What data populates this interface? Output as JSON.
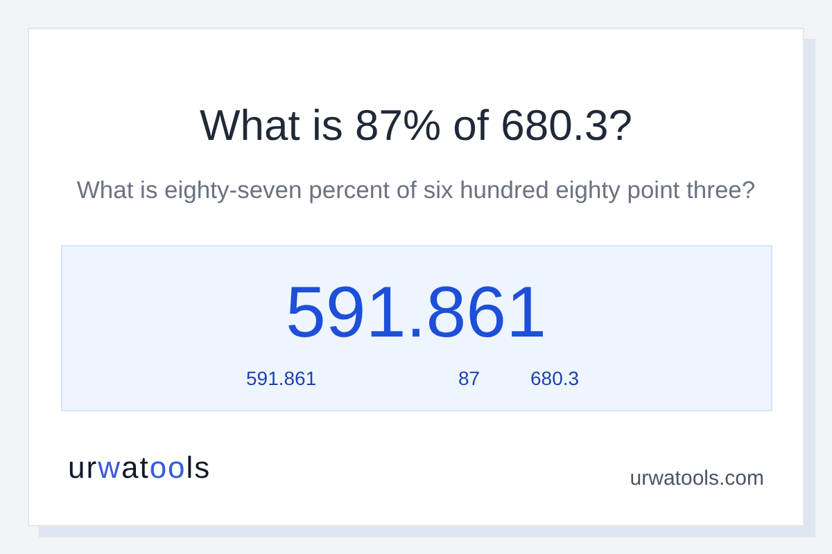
{
  "title": "What is 87% of 680.3?",
  "subtitle": "What is eighty-seven percent of six hundred eighty point three?",
  "result": {
    "value": "591.861",
    "parts": [
      "591.861",
      "87",
      "680.3"
    ]
  },
  "logo": [
    {
      "text": "ur",
      "accent": false
    },
    {
      "text": "w",
      "accent": true
    },
    {
      "text": "at",
      "accent": false
    },
    {
      "text": "oo",
      "accent": true
    },
    {
      "text": "ls",
      "accent": false
    }
  ],
  "site": "urwatools.com"
}
